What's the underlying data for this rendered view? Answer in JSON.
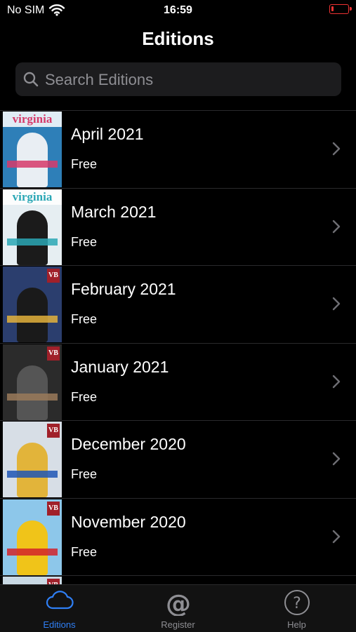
{
  "status_bar": {
    "carrier": "No SIM",
    "time": "16:59",
    "battery_color": "#e33333"
  },
  "nav": {
    "title": "Editions"
  },
  "search": {
    "placeholder": "Search Editions"
  },
  "editions": [
    {
      "title": "April 2021",
      "price": "Free",
      "cover": {
        "masthead": "virginia",
        "bg": "#2e7fb8",
        "accent": "#d63a6a",
        "figure": "#e9eef3"
      }
    },
    {
      "title": "March 2021",
      "price": "Free",
      "cover": {
        "masthead": "virginia",
        "bg": "#e6eef2",
        "accent": "#2aa7b5",
        "figure": "#1b1b1b"
      }
    },
    {
      "title": "February 2021",
      "price": "Free",
      "cover": {
        "masthead": "VB",
        "bg": "#2b3e6e",
        "accent": "#e3b23c",
        "figure": "#1a1a1a"
      }
    },
    {
      "title": "January 2021",
      "price": "Free",
      "cover": {
        "masthead": "VB",
        "bg": "#2b2b2b",
        "accent": "#9a7a5a",
        "figure": "#555555"
      }
    },
    {
      "title": "December 2020",
      "price": "Free",
      "cover": {
        "masthead": "VB",
        "bg": "#d7dee6",
        "accent": "#1f56b5",
        "figure": "#e2b43a"
      }
    },
    {
      "title": "November 2020",
      "price": "Free",
      "cover": {
        "masthead": "VB",
        "bg": "#8dc7ea",
        "accent": "#d2232a",
        "figure": "#f0c419"
      }
    },
    {
      "title": "",
      "price": "",
      "cover": {
        "masthead": "VB",
        "bg": "#c9d9e4",
        "accent": "#a0202a",
        "figure": "#888888"
      }
    }
  ],
  "tabs": [
    {
      "label": "Editions",
      "icon": "cloud-icon",
      "active": true
    },
    {
      "label": "Register",
      "icon": "at-sign-icon",
      "active": false
    },
    {
      "label": "Help",
      "icon": "question-mark-icon",
      "active": false
    }
  ],
  "colors": {
    "accent": "#2f7ff5",
    "tab_inactive": "#8e8e93",
    "background": "#000000"
  }
}
